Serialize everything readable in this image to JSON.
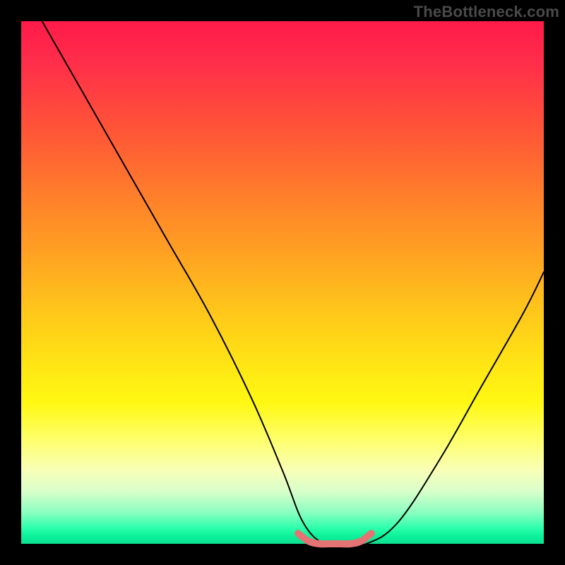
{
  "watermark": "TheBottleneck.com",
  "chart_data": {
    "type": "line",
    "title": "",
    "xlabel": "",
    "ylabel": "",
    "xlim": [
      0,
      100
    ],
    "ylim": [
      0,
      100
    ],
    "grid": false,
    "legend": false,
    "series": [
      {
        "name": "bottleneck-curve",
        "color": "#000000",
        "x": [
          4,
          12,
          20,
          28,
          36,
          44,
          50,
          54,
          58,
          62,
          66,
          72,
          80,
          88,
          96,
          100
        ],
        "y": [
          100,
          86,
          72,
          58,
          44,
          28,
          14,
          4,
          0,
          0,
          0,
          4,
          16,
          30,
          44,
          52
        ]
      },
      {
        "name": "optimal-range-marker",
        "color": "#e57373",
        "x": [
          53,
          55,
          57,
          59,
          61,
          63,
          65,
          67
        ],
        "y": [
          2,
          0.5,
          0,
          0,
          0,
          0,
          0.5,
          2
        ]
      }
    ],
    "background_gradient": {
      "stops": [
        {
          "pos": 0,
          "color": "#ff1a4a"
        },
        {
          "pos": 20,
          "color": "#ff5238"
        },
        {
          "pos": 44,
          "color": "#ffa022"
        },
        {
          "pos": 66,
          "color": "#ffe614"
        },
        {
          "pos": 86,
          "color": "#f8ffb8"
        },
        {
          "pos": 97,
          "color": "#2cffac"
        },
        {
          "pos": 100,
          "color": "#0ce090"
        }
      ]
    }
  }
}
